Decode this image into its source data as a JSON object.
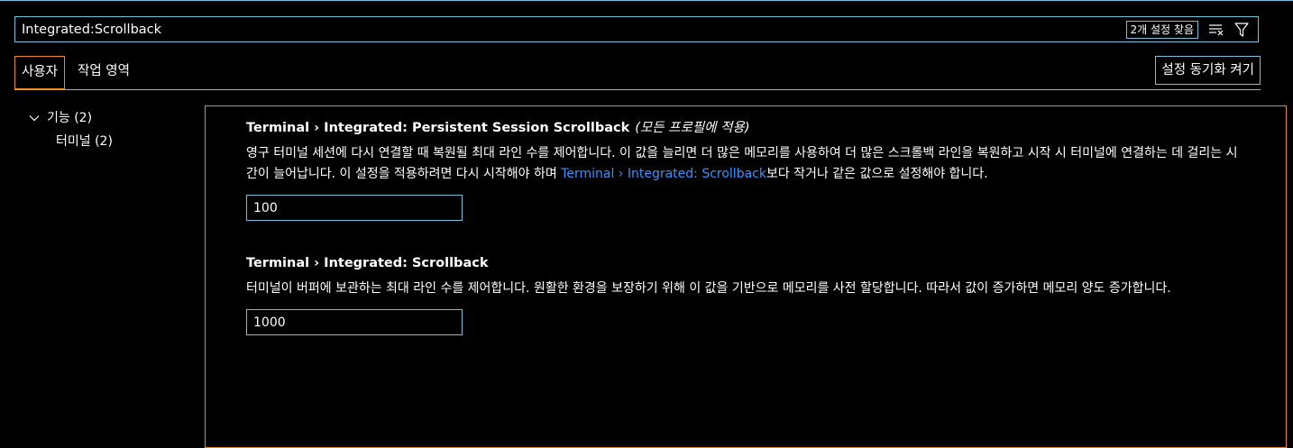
{
  "search": {
    "value": "Integrated:Scrollback",
    "results_count": "2개 설정 찾음",
    "clear_icon": "clear-filter-icon",
    "filter_icon": "filter-icon"
  },
  "tabs": [
    {
      "label": "사용자",
      "active": true
    },
    {
      "label": "작업 영역",
      "active": false
    }
  ],
  "sync_button": {
    "label": "설정 동기화 켜기"
  },
  "toc": {
    "group": {
      "label": "기능 (2)",
      "expanded": true
    },
    "items": [
      {
        "label": "터미널 (2)"
      }
    ]
  },
  "settings": [
    {
      "title": "Terminal › Integrated: Persistent Session Scrollback",
      "scope": "(모든 프로필에 적용)",
      "desc_before": "영구 터미널 세션에 다시 연결할 때 복원될 최대 라인 수를 제어합니다. 이 값을 늘리면 더 많은 메모리를 사용하여 더 많은 스크롤백 라인을 복원하고 시작 시 터미널에 연결하는 데 걸리는 시간이 늘어납니다. 이 설정을 적용하려면 다시 시작해야 하며 ",
      "desc_link": "Terminal › Integrated: Scrollback",
      "desc_after": "보다 작거나 같은 값으로 설정해야 합니다.",
      "value": "100"
    },
    {
      "title": "Terminal › Integrated: Scrollback",
      "description": "터미널이 버퍼에 보관하는 최대 라인 수를 제어합니다. 원활한 환경을 보장하기 위해 이 값을 기반으로 메모리를 사전 할당합니다. 따라서 값이 증가하면 메모리 양도 증가합니다.",
      "value": "1000"
    }
  ],
  "colors": {
    "focus_border": "#6fc3df",
    "active_border": "#f38518",
    "link": "#3794ff",
    "background": "#000000"
  }
}
